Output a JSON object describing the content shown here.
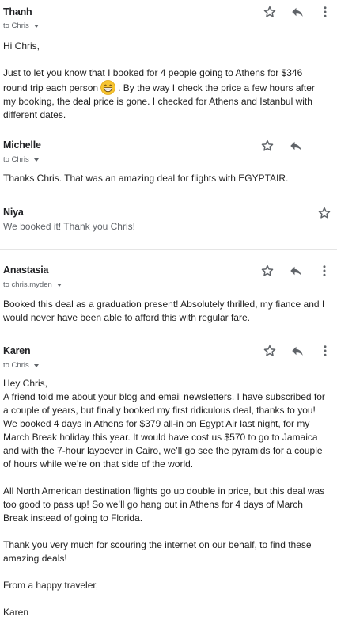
{
  "messages": [
    {
      "sender": "Thanh",
      "to": "to Chris",
      "lines_a": "Hi Chris,",
      "lines_b1": "Just to let you know that I booked for 4 people going to Athens for $346 round trip each person",
      "lines_b2": ". By the way I check the price a few hours after my booking, the deal price is gone. I checked for Athens and Istanbul with different dates.",
      "emoji": "grinning-face-emoji"
    },
    {
      "sender": "Michelle",
      "to": "to Chris",
      "body": "Thanks Chris.  That was an amazing deal for flights with EGYPTAIR."
    },
    {
      "sender": "Niya",
      "body": "We booked it! Thank you Chris!"
    },
    {
      "sender": "Anastasia",
      "to": "to chris.myden",
      "body": "Booked this deal as a graduation present! Absolutely thrilled, my fiance and I would never have been able to afford this with regular fare."
    },
    {
      "sender": "Karen",
      "to": "to Chris",
      "p1": "Hey Chris,",
      "p2": "A friend told me about your blog and email newsletters. I have subscribed for a couple of years, but finally booked my first ridiculous deal, thanks to you!",
      "p3": "We booked 4 days in Athens for $379 all-in on Egypt Air last night, for my March Break holiday this year. It would have cost us $570 to go to Jamaica and with the 7-hour layoever in Cairo, we’ll go see the pyramids for a couple of hours while we’re on that side of the world.",
      "p4": "All North American destination flights go up double in price, but this deal was too good to pass up! So we’ll go hang out in Athens for 4 days of March Break instead of going to Florida.",
      "p5": "Thank you very much for scouring the internet on our behalf, to find these amazing deals!",
      "p6": "From a happy traveler,",
      "p7": "Karen"
    }
  ],
  "icons": {
    "star": "star-icon",
    "reply": "reply-icon",
    "more": "more-vert-icon",
    "caret": "chevron-down-icon"
  },
  "colors": {
    "text": "#222222",
    "muted": "#5f6368",
    "icon": "#5f6368",
    "divider": "#e5e5e5"
  }
}
